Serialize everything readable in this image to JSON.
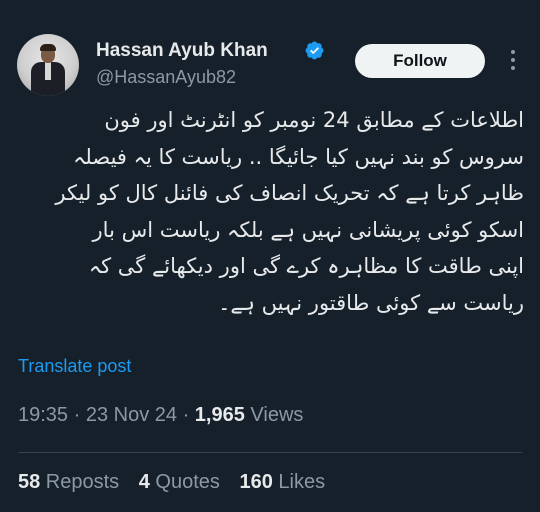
{
  "author": {
    "name": "Hassan Ayub Khan",
    "handle": "@HassanAyub82",
    "verified": true
  },
  "follow_label": "Follow",
  "tweet_lines": [
    "اطلاعات کے مطابق 24 نومبر کو انٹرنٹ اور فون",
    "سروس کو بند نہیں کیا جائیگا .. ریاست کا یہ فیصلہ",
    "ظاہر کرتا ہے کہ تحریک انصاف کی فائنل کال کو لیکر",
    "اسکو کوئی پریشانی نہیں ہے بلکہ ریاست اس بار",
    "اپنی طاقت کا مظاہرہ کرے گی اور دیکھائے گی کہ",
    "ریاست سے کوئی طاقتور نہیں ہے۔"
  ],
  "translate_label": "Translate post",
  "meta": {
    "time": "19:35",
    "sep1": " · ",
    "date": "23 Nov 24",
    "sep2": " · ",
    "views_count": "1,965",
    "views_label": " Views"
  },
  "stats": {
    "reposts_count": "58",
    "reposts_label": " Reposts",
    "quotes_count": "4",
    "quotes_label": " Quotes",
    "likes_count": "160",
    "likes_label": " Likes"
  },
  "colors": {
    "background": "#15202b",
    "text": "#e7e9ea",
    "secondary": "#8b98a5",
    "link": "#1d9bf0",
    "verified": "#1d9bf0",
    "button_bg": "#eff3f4"
  },
  "icons": [
    "verified-badge-icon",
    "more-options-icon"
  ]
}
